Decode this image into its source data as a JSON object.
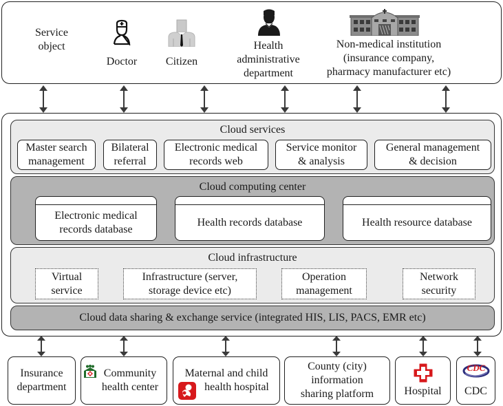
{
  "service_objects": {
    "label": "Service object",
    "items": [
      {
        "label": "Doctor",
        "icon": "doctor-icon"
      },
      {
        "label": "Citizen",
        "icon": "citizen-icon"
      },
      {
        "label": "Health administrative department",
        "icon": "admin-person-icon"
      },
      {
        "label": "Non-medical institution (insurance company, pharmacy manufacturer etc)",
        "icon": "building-icon"
      }
    ],
    "lines": {
      "service_1": "Service",
      "service_2": "object",
      "doctor": "Doctor",
      "citizen": "Citizen",
      "health_1": "Health",
      "health_2": "administrative",
      "health_3": "department",
      "nonmed_1": "Non-medical institution",
      "nonmed_2": "(insurance company,",
      "nonmed_3": "pharmacy manufacturer etc)"
    }
  },
  "cloud_services": {
    "title": "Cloud services",
    "items": [
      {
        "l1": "Master search",
        "l2": "management"
      },
      {
        "l1": "Bilateral",
        "l2": "referral"
      },
      {
        "l1": "Electronic medical",
        "l2": "records web"
      },
      {
        "l1": "Service monitor",
        "l2": "& analysis"
      },
      {
        "l1": "General management",
        "l2": "& decision"
      }
    ]
  },
  "cloud_computing": {
    "title": "Cloud computing center",
    "databases": [
      {
        "l1": "Electronic medical",
        "l2": "records database"
      },
      {
        "l1": "Health records database",
        "l2": ""
      },
      {
        "l1": "Health resource database",
        "l2": ""
      }
    ]
  },
  "cloud_infrastructure": {
    "title": "Cloud infrastructure",
    "items": [
      {
        "l1": "Virtual",
        "l2": "service"
      },
      {
        "l1": "Infrastructure (server,",
        "l2": "storage device etc)"
      },
      {
        "l1": "Operation",
        "l2": "management"
      },
      {
        "l1": "Network",
        "l2": "security"
      }
    ]
  },
  "sharing": {
    "title": "Cloud data sharing & exchange service (integrated HIS, LIS, PACS, EMR etc)"
  },
  "institutions": [
    {
      "l1": "Insurance",
      "l2": "department",
      "icon": ""
    },
    {
      "l1": "Community",
      "l2": "health center",
      "icon": "community-health-icon"
    },
    {
      "l1": "Maternal and child",
      "l2": "health hospital",
      "icon": "maternal-child-icon"
    },
    {
      "l1": "County (city)",
      "l2": "information",
      "l3": "sharing platform",
      "icon": ""
    },
    {
      "l1": "Hospital",
      "icon": "red-cross-icon"
    },
    {
      "l1": "CDC",
      "icon": "cdc-logo-icon"
    }
  ],
  "colors": {
    "light_layer": "#ebebeb",
    "dark_layer": "#b3b3b3",
    "red": "#d7191c",
    "green": "#1f6b2a",
    "navy": "#2b2d7a"
  }
}
